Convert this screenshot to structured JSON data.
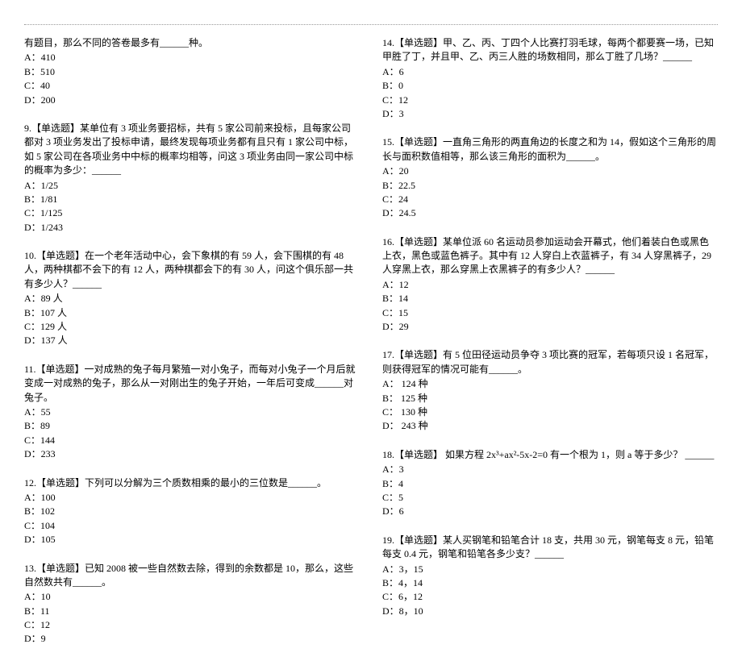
{
  "left": {
    "carryover": {
      "stem": "有题目，那么不同的答卷最多有______种。",
      "opts": [
        "A：410",
        "B：510",
        "C：40",
        "D：200"
      ]
    },
    "q9": {
      "stem": "9.【单选题】某单位有 3 项业务要招标，共有 5 家公司前来投标，且每家公司都对 3 项业务发出了投标申请，最终发现每项业务都有且只有 1 家公司中标，如 5 家公司在各项业务中中标的概率均相等，问这 3 项业务由同一家公司中标的概率为多少：______",
      "opts": [
        "A：1/25",
        "B：1/81",
        "C：1/125",
        "D：1/243"
      ]
    },
    "q10": {
      "stem": "10.【单选题】在一个老年活动中心，会下象棋的有 59 人，会下围棋的有 48 人，两种棋都不会下的有 12 人，两种棋都会下的有 30 人，问这个俱乐部一共有多少人？______",
      "opts": [
        "A：89 人",
        "B：107 人",
        "C：129 人",
        "D：137 人"
      ]
    },
    "q11": {
      "stem": "11.【单选题】一对成熟的兔子每月繁殖一对小兔子，而每对小兔子一个月后就变成一对成熟的兔子，那么从一对刚出生的兔子开始，一年后可变成______对兔子。",
      "opts": [
        "A：55",
        "B：89",
        "C：144",
        "D：233"
      ]
    },
    "q12": {
      "stem": "12.【单选题】下列可以分解为三个质数相乘的最小的三位数是______。",
      "opts": [
        "A：100",
        "B：102",
        "C：104",
        "D：105"
      ]
    },
    "q13": {
      "stem": "13.【单选题】已知 2008 被一些自然数去除，得到的余数都是 10，那么，这些自然数共有______。",
      "opts": [
        "A：10",
        "B：11",
        "C：12",
        "D：9"
      ]
    }
  },
  "right": {
    "q14": {
      "stem": "14.【单选题】甲、乙、丙、丁四个人比赛打羽毛球，每两个都要赛一场，已知甲胜了丁，并且甲、乙、丙三人胜的场数相同，那么丁胜了几场？______",
      "opts": [
        "A：6",
        "B：0",
        "C：12",
        "D：3"
      ]
    },
    "q15": {
      "stem": "15.【单选题】一直角三角形的两直角边的长度之和为 14，假如这个三角形的周长与面积数值相等，那么该三角形的面积为______。",
      "opts": [
        "A：20",
        "B：22.5",
        "C：24",
        "D：24.5"
      ]
    },
    "q16": {
      "stem": "16.【单选题】某单位派 60 名运动员参加运动会开幕式，他们着装白色或黑色上衣，黑色或蓝色裤子。其中有 12 人穿白上衣蓝裤子，有 34 人穿黑裤子，29 人穿黑上衣，那么穿黑上衣黑裤子的有多少人？______",
      "opts": [
        "A：12",
        "B：14",
        "C：15",
        "D：29"
      ]
    },
    "q17": {
      "stem": "17.【单选题】有 5 位田径运动员争夺 3 项比赛的冠军，若每项只设 1 名冠军，则获得冠军的情况可能有______。",
      "opts": [
        "A： 124 种",
        "B： 125 种",
        "C： 130 种",
        "D： 243 种"
      ]
    },
    "q18": {
      "stem": "18.【单选题】 如果方程 2x³+ax²-5x-2=0 有一个根为 1，则 a 等于多少？ ______",
      "opts": [
        "A：3",
        "B：4",
        "C：5",
        "D：6"
      ]
    },
    "q19": {
      "stem": "19.【单选题】某人买钢笔和铅笔合计 18 支，共用 30 元，钢笔每支 8 元，铅笔每支 0.4 元，钢笔和铅笔各多少支？______",
      "opts": [
        "A：3，15",
        "B：4，14",
        "C：6，12",
        "D：8，10"
      ]
    }
  }
}
